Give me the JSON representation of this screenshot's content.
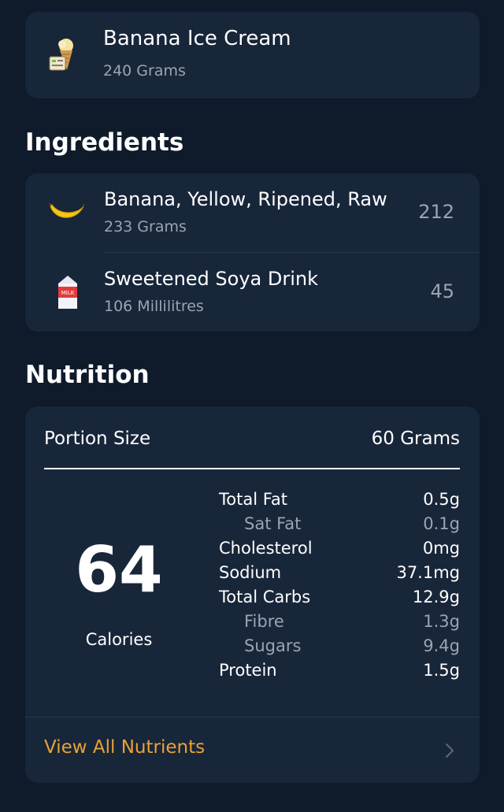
{
  "recipe": {
    "title": "Banana Ice Cream",
    "quantity": "240 Grams",
    "icon": "ice-cream-icon"
  },
  "ingredients": {
    "heading": "Ingredients",
    "items": [
      {
        "name": "Banana, Yellow, Ripened, Raw",
        "quantity": "233 Grams",
        "calories": "212",
        "icon": "banana-icon"
      },
      {
        "name": "Sweetened Soya Drink",
        "quantity": "106 Millilitres",
        "calories": "45",
        "icon": "milk-carton-icon",
        "icon_text": "MILK"
      }
    ]
  },
  "nutrition": {
    "heading": "Nutrition",
    "portion_label": "Portion Size",
    "portion_value": "60 Grams",
    "calories": "64",
    "calories_label": "Calories",
    "rows": [
      {
        "name": "Total Fat",
        "value": "0.5g",
        "sub": false
      },
      {
        "name": "Sat Fat",
        "value": "0.1g",
        "sub": true
      },
      {
        "name": "Cholesterol",
        "value": "0mg",
        "sub": false
      },
      {
        "name": "Sodium",
        "value": "37.1mg",
        "sub": false
      },
      {
        "name": "Total Carbs",
        "value": "12.9g",
        "sub": false
      },
      {
        "name": "Fibre",
        "value": "1.3g",
        "sub": true
      },
      {
        "name": "Sugars",
        "value": "9.4g",
        "sub": true
      },
      {
        "name": "Protein",
        "value": "1.5g",
        "sub": false
      }
    ],
    "view_all": "View All Nutrients"
  },
  "colors": {
    "background": "#0f1a2a",
    "card": "#18263a",
    "accent": "#e9a236",
    "muted": "#9aa4b2"
  }
}
